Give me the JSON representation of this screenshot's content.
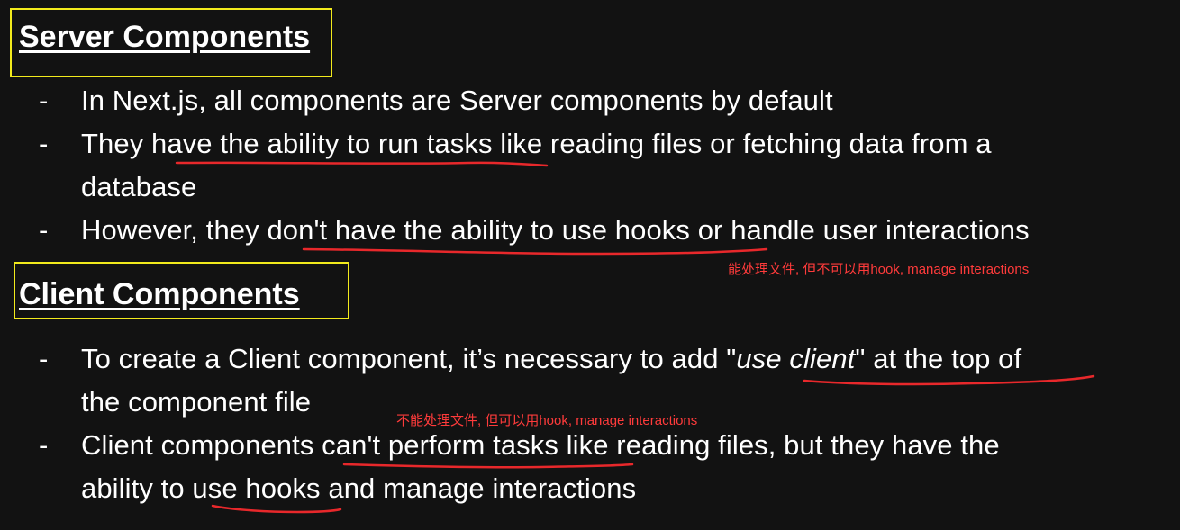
{
  "server": {
    "heading": "Server Components",
    "bullet": "-",
    "line1": "In Next.js, all components are Server components by default",
    "line2": "They have the ability to run tasks like reading files or fetching data from a",
    "line3": "database",
    "line4": "However, they don't have the ability to use hooks or handle user interactions",
    "note": "能处理文件, 但不可以用hook, manage interactions"
  },
  "client": {
    "heading": "Client Components",
    "bullet": "-",
    "line1_prefix": "To create a Client component, it’s necessary to add \"",
    "line1_italic": "use client",
    "line1_suffix": "\" at the top of",
    "line2": "the component file",
    "note": "不能处理文件, 但可以用hook, manage interactions",
    "line3": "Client components can't perform tasks like reading files, but they have the",
    "line4": "ability to use hooks and manage interactions"
  },
  "colors": {
    "background": "#121212",
    "highlight_box": "#f2ea1c",
    "annotation": "#e8282b"
  }
}
